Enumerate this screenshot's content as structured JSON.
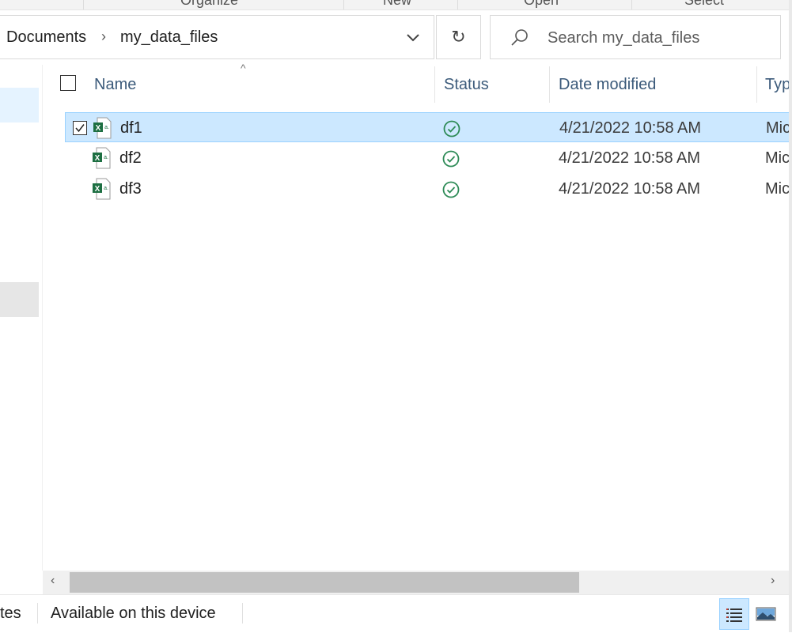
{
  "ribbon": {
    "items": [
      "Organize",
      "New",
      "Open",
      "Select"
    ]
  },
  "address": {
    "crumbs": [
      "Documents",
      "my_data_files"
    ],
    "separator": "›"
  },
  "refresh_glyph": "↻",
  "search": {
    "placeholder": "Search my_data_files"
  },
  "columns": {
    "name": "Name",
    "status": "Status",
    "date": "Date modified",
    "type": "Typ"
  },
  "files": [
    {
      "name": "df1",
      "date": "4/21/2022 10:58 AM",
      "type": "Mic",
      "selected": true
    },
    {
      "name": "df2",
      "date": "4/21/2022 10:58 AM",
      "type": "Mic",
      "selected": false
    },
    {
      "name": "df3",
      "date": "4/21/2022 10:58 AM",
      "type": "Mic",
      "selected": false
    }
  ],
  "statusbar": {
    "left_fragment": "tes",
    "availability": "Available on this device"
  },
  "colors": {
    "accent": "#cce8ff",
    "ok_green": "#2e8b57",
    "excel_green": "#1d6f42"
  }
}
